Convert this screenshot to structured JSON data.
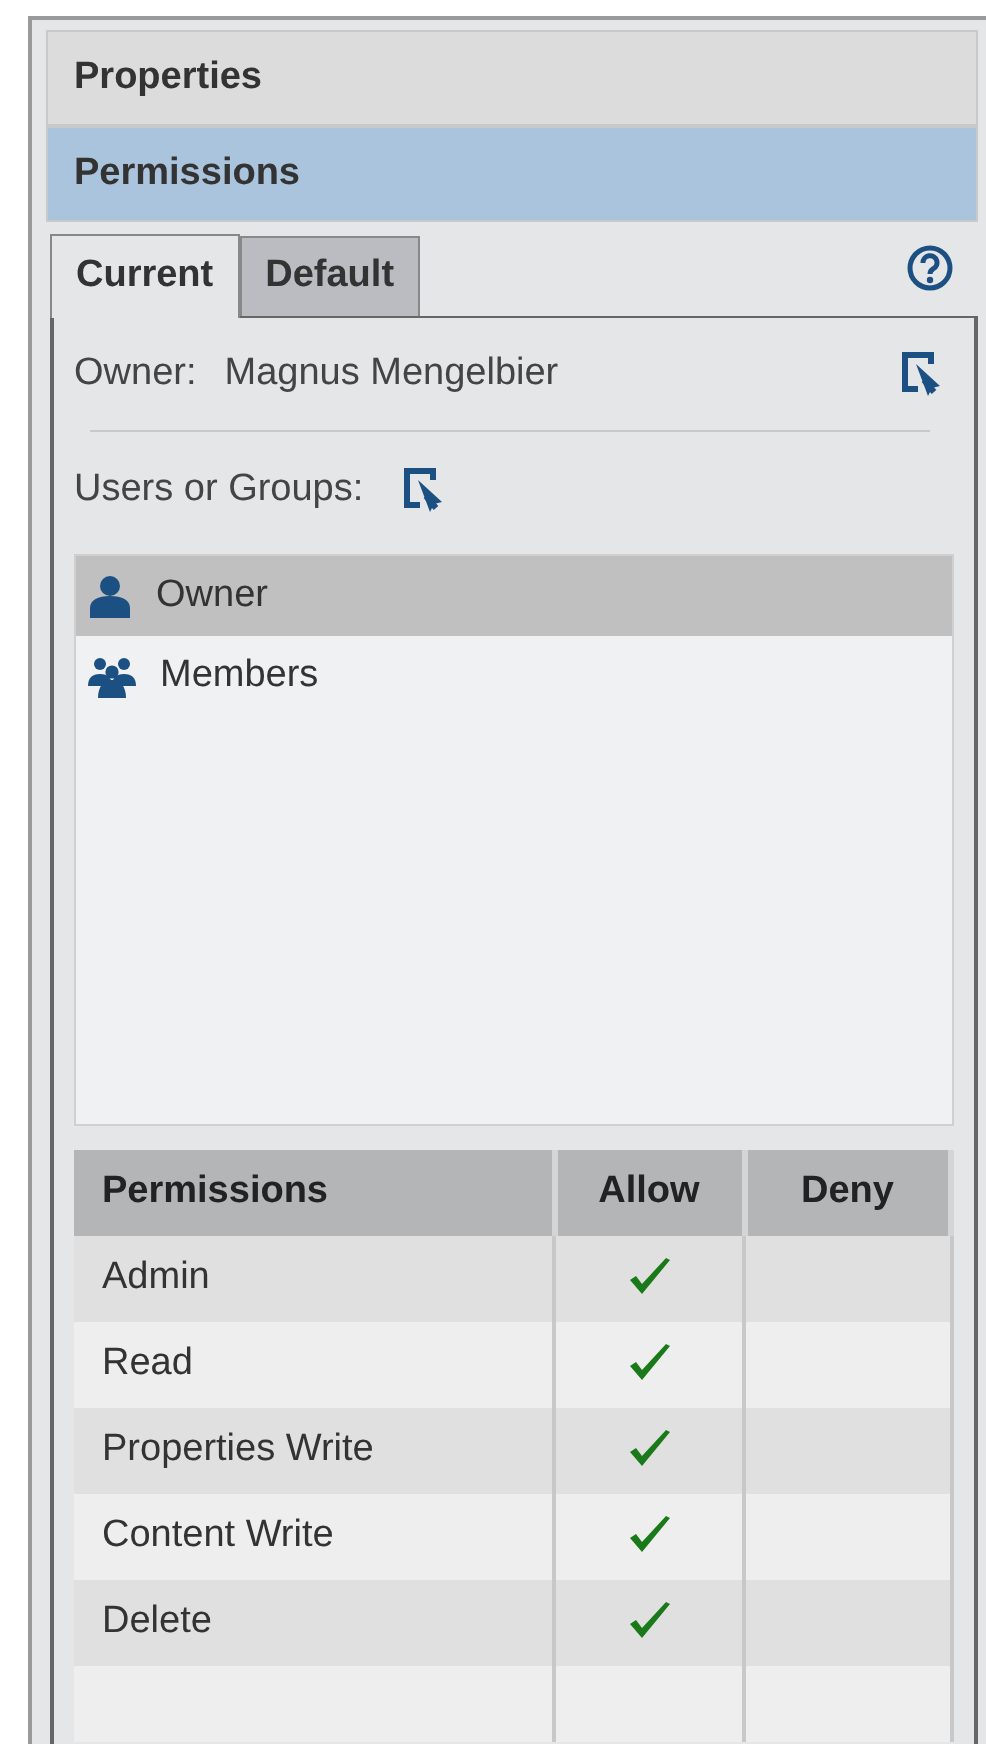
{
  "sections": [
    {
      "title": "Properties",
      "selected": false
    },
    {
      "title": "Permissions",
      "selected": true
    }
  ],
  "tabs": [
    {
      "label": "Current",
      "selected": true
    },
    {
      "label": "Default",
      "selected": false
    }
  ],
  "owner": {
    "label": "Owner:",
    "value": "Magnus Mengelbier"
  },
  "users_label": "Users or Groups:",
  "principals": [
    {
      "name": "Owner",
      "kind": "user",
      "selected": true
    },
    {
      "name": "Members",
      "kind": "group",
      "selected": false
    }
  ],
  "permissions": {
    "columns": [
      "Permissions",
      "Allow",
      "Deny"
    ],
    "rows": [
      {
        "name": "Admin",
        "allow": true,
        "deny": false
      },
      {
        "name": "Read",
        "allow": true,
        "deny": false
      },
      {
        "name": "Properties Write",
        "allow": true,
        "deny": false
      },
      {
        "name": "Content Write",
        "allow": true,
        "deny": false
      },
      {
        "name": "Delete",
        "allow": true,
        "deny": false
      }
    ]
  }
}
